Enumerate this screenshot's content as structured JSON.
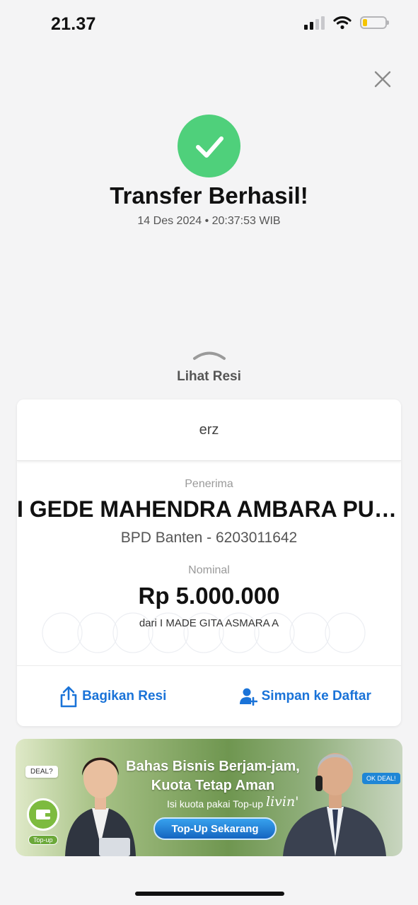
{
  "status_bar": {
    "time": "21.37",
    "battery_level": 0.2
  },
  "header": {
    "close_icon": "close-icon"
  },
  "success": {
    "icon": "check-circle-icon",
    "title": "Transfer Berhasil!",
    "datetime": "14 Des 2024 • 20:37:53 WIB"
  },
  "receipt_toggle": {
    "label": "Lihat Resi",
    "icon": "chevron-up-icon"
  },
  "receipt": {
    "note": "erz",
    "recipient_label": "Penerima",
    "recipient_name": "I GEDE MAHENDRA AMBARA PUT...",
    "recipient_bank": "BPD Banten - 6203011642",
    "amount_label": "Nominal",
    "amount": "Rp 5.000.000",
    "sender": "dari I MADE GITA ASMARA A",
    "actions": {
      "share_label": "Bagikan Resi",
      "share_icon": "share-icon",
      "save_label": "Simpan ke Daftar",
      "save_icon": "add-user-icon"
    }
  },
  "promo": {
    "headline_line1": "Bahas Bisnis Berjam-jam,",
    "headline_line2": "Kuota Tetap Aman",
    "subtext": "Isi kuota pakai Top-up",
    "brand": "livin'",
    "cta": "Top-Up Sekarang",
    "bubble_left": "DEAL?",
    "bubble_right": "OK DEAL!",
    "topup_label": "Top-up"
  },
  "colors": {
    "success_green": "#4fd07b",
    "action_blue": "#1a73d8",
    "background": "#f4f4f5"
  }
}
